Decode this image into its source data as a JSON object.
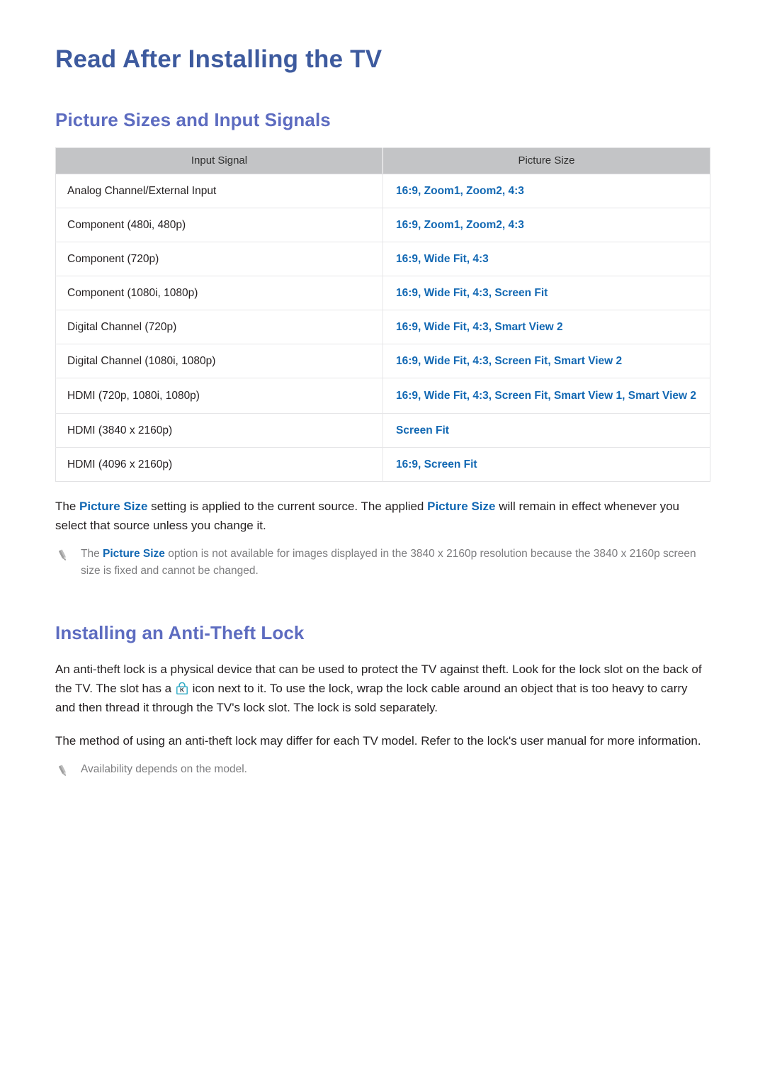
{
  "document": {
    "title": "Read After Installing the TV"
  },
  "sections": [
    {
      "heading": "Picture Sizes and Input Signals",
      "table": {
        "headers": [
          "Input Signal",
          "Picture Size"
        ],
        "rows": [
          {
            "signal": "Analog Channel/External Input",
            "size": "16:9, Zoom1, Zoom2, 4:3"
          },
          {
            "signal": "Component (480i, 480p)",
            "size": "16:9, Zoom1, Zoom2, 4:3"
          },
          {
            "signal": "Component (720p)",
            "size": "16:9, Wide Fit, 4:3"
          },
          {
            "signal": "Component (1080i, 1080p)",
            "size": "16:9, Wide Fit, 4:3, Screen Fit"
          },
          {
            "signal": "Digital Channel (720p)",
            "size": "16:9, Wide Fit, 4:3, Smart View 2"
          },
          {
            "signal": "Digital Channel (1080i, 1080p)",
            "size": "16:9, Wide Fit, 4:3, Screen Fit, Smart View 2"
          },
          {
            "signal": "HDMI (720p, 1080i, 1080p)",
            "size": "16:9, Wide Fit, 4:3, Screen Fit, Smart View 1, Smart View 2"
          },
          {
            "signal": "HDMI (3840 x 2160p)",
            "size": "Screen Fit"
          },
          {
            "signal": "HDMI (4096 x 2160p)",
            "size": "16:9, Screen Fit"
          }
        ]
      },
      "paragraph": {
        "part1": "The ",
        "term1": "Picture Size",
        "part2": " setting is applied to the current source. The applied ",
        "term2": "Picture Size",
        "part3": " will remain in effect whenever you select that source unless you change it."
      },
      "note": {
        "part1": "The ",
        "term1": "Picture Size",
        "part2": " option is not available for images displayed in the 3840 x 2160p resolution because the 3840 x 2160p screen size is fixed and cannot be changed."
      }
    },
    {
      "heading": "Installing an Anti-Theft Lock",
      "paragraph1": {
        "part1": "An anti-theft lock is a physical device that can be used to protect the TV against theft. Look for the lock slot on the back of the TV. The slot has a ",
        "icon": "kensington-lock-icon",
        "part2": " icon next to it. To use the lock, wrap the lock cable around an object that is too heavy to carry and then thread it through the TV's lock slot. The lock is sold separately."
      },
      "paragraph2": "The method of using an anti-theft lock may differ for each TV model. Refer to the lock's user manual for more information.",
      "note": "Availability depends on the model."
    }
  ],
  "colors": {
    "title_blue": "#3d5a9e",
    "heading_purple": "#5d6cc0",
    "link_blue": "#1268b3",
    "body_text": "#231f20",
    "note_gray": "#7c7c7e",
    "table_header_bg": "#c3c4c6",
    "lock_icon_teal": "#2aa8c4"
  }
}
